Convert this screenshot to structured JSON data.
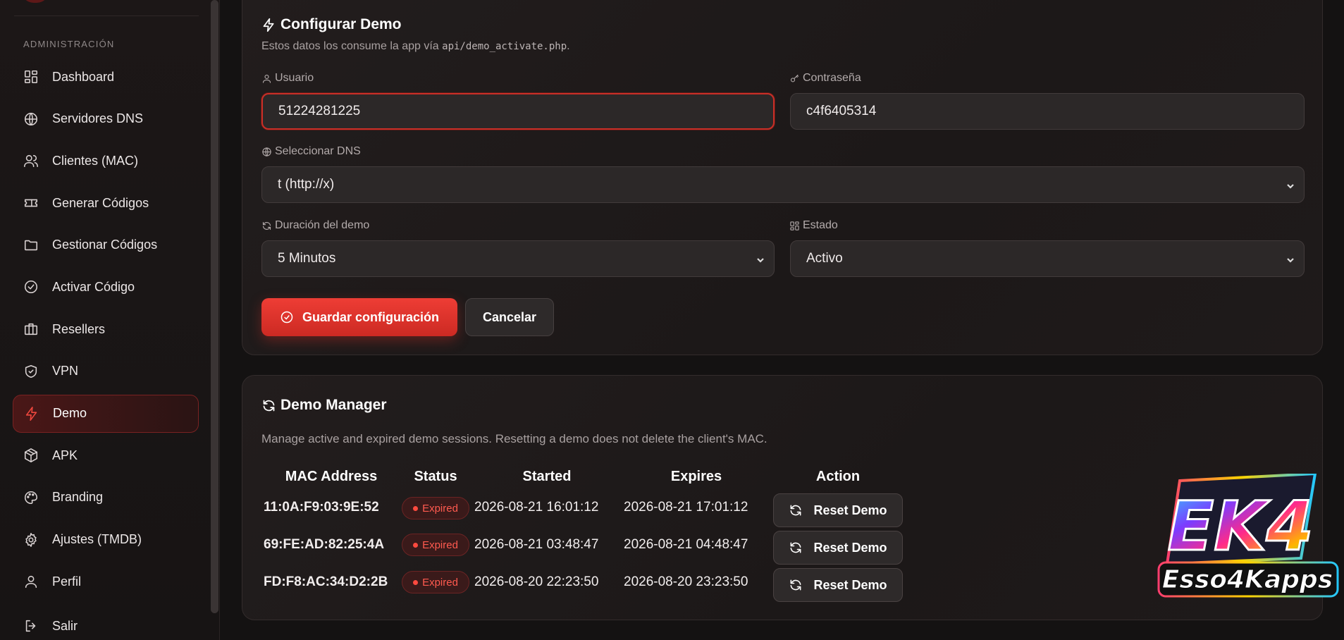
{
  "sidebar": {
    "section_label": "ADMINISTRACIÓN",
    "items": [
      {
        "label": "Dashboard",
        "icon": "dashboard-icon"
      },
      {
        "label": "Servidores DNS",
        "icon": "globe-icon"
      },
      {
        "label": "Clientes (MAC)",
        "icon": "users-icon"
      },
      {
        "label": "Generar Códigos",
        "icon": "ticket-icon"
      },
      {
        "label": "Gestionar Códigos",
        "icon": "folder-icon"
      },
      {
        "label": "Activar Código",
        "icon": "check-circle-icon"
      },
      {
        "label": "Resellers",
        "icon": "briefcase-icon"
      },
      {
        "label": "VPN",
        "icon": "shield-icon"
      },
      {
        "label": "Demo",
        "icon": "lightning-icon",
        "active": true
      },
      {
        "label": "APK",
        "icon": "package-icon"
      },
      {
        "label": "Branding",
        "icon": "palette-icon"
      },
      {
        "label": "Ajustes (TMDB)",
        "icon": "gear-icon"
      },
      {
        "label": "Perfil",
        "icon": "user-icon"
      },
      {
        "label": "Salir",
        "icon": "logout-icon"
      }
    ]
  },
  "config": {
    "title": "Configurar Demo",
    "subtitle_prefix": "Estos datos los consume la app vía ",
    "subtitle_code": "api/demo_activate.php",
    "subtitle_suffix": ".",
    "usuario_label": "Usuario",
    "usuario_value": "51224281225",
    "password_label": "Contraseña",
    "password_value": "c4f6405314",
    "dns_label": "Seleccionar DNS",
    "dns_value": "t (http://x)",
    "duracion_label": "Duración del demo",
    "duracion_value": "5 Minutos",
    "estado_label": "Estado",
    "estado_value": "Activo",
    "save_label": "Guardar configuración",
    "cancel_label": "Cancelar"
  },
  "manager": {
    "title": "Demo Manager",
    "subtitle": "Manage active and expired demo sessions. Resetting a demo does not delete the client's MAC.",
    "headers": [
      "MAC Address",
      "Status",
      "Started",
      "Expires",
      "Action"
    ],
    "rows": [
      {
        "mac": "11:0A:F9:03:9E:52",
        "status": "Expired",
        "started": "2026-08-21 16:01:12",
        "expires": "2026-08-21 17:01:12",
        "action": "Reset Demo"
      },
      {
        "mac": "69:FE:AD:82:25:4A",
        "status": "Expired",
        "started": "2026-08-21 03:48:47",
        "expires": "2026-08-21 04:48:47",
        "action": "Reset Demo"
      },
      {
        "mac": "FD:F8:AC:34:D2:2B",
        "status": "Expired",
        "started": "2026-08-20 22:23:50",
        "expires": "2026-08-20 23:23:50",
        "action": "Reset Demo"
      }
    ]
  },
  "logo": {
    "text_top": "EK4",
    "text_bottom": "Esso4Kapps"
  },
  "colors": {
    "accent": "#e8352d",
    "background": "#141212"
  }
}
